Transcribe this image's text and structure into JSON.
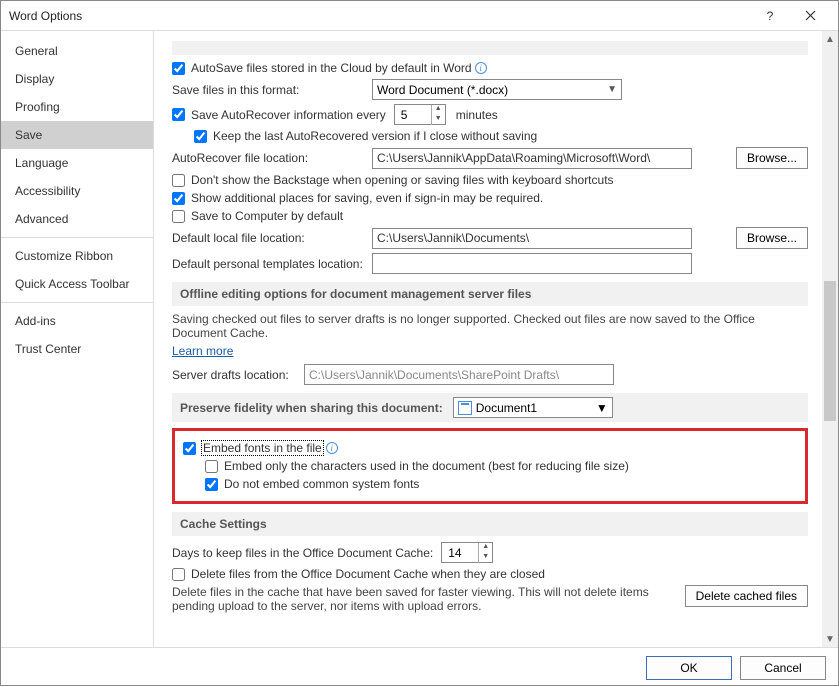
{
  "title": "Word Options",
  "sidebar": {
    "items": [
      {
        "label": "General"
      },
      {
        "label": "Display"
      },
      {
        "label": "Proofing"
      },
      {
        "label": "Save"
      },
      {
        "label": "Language"
      },
      {
        "label": "Accessibility"
      },
      {
        "label": "Advanced"
      },
      {
        "label": "Customize Ribbon"
      },
      {
        "label": "Quick Access Toolbar"
      },
      {
        "label": "Add-ins"
      },
      {
        "label": "Trust Center"
      }
    ]
  },
  "save": {
    "autosave_label": "AutoSave files stored in the Cloud by default in Word",
    "format_label": "Save files in this format:",
    "format_value": "Word Document (*.docx)",
    "autorecover_label": "Save AutoRecover information every",
    "autorecover_minutes": "5",
    "minutes_label": "minutes",
    "keep_last_label": "Keep the last AutoRecovered version if I close without saving",
    "recover_loc_label": "AutoRecover file location:",
    "recover_loc_value": "C:\\Users\\Jannik\\AppData\\Roaming\\Microsoft\\Word\\",
    "browse_label": "Browse...",
    "dont_show_backstage": "Don't show the Backstage when opening or saving files with keyboard shortcuts",
    "show_additional": "Show additional places for saving, even if sign-in may be required.",
    "save_computer": "Save to Computer by default",
    "default_local_label": "Default local file location:",
    "default_local_value": "C:\\Users\\Jannik\\Documents\\",
    "personal_templates_label": "Default personal templates location:",
    "personal_templates_value": ""
  },
  "offline": {
    "header": "Offline editing options for document management server files",
    "desc": "Saving checked out files to server drafts is no longer supported. Checked out files are now saved to the Office Document Cache.",
    "learn_more": "Learn more",
    "drafts_label": "Server drafts location:",
    "drafts_value": "C:\\Users\\Jannik\\Documents\\SharePoint Drafts\\"
  },
  "preserve": {
    "header": "Preserve fidelity when sharing this document:",
    "doc_value": "Document1",
    "embed_fonts": "Embed fonts in the file",
    "embed_chars": "Embed only the characters used in the document (best for reducing file size)",
    "no_common": "Do not embed common system fonts"
  },
  "cache": {
    "header": "Cache Settings",
    "days_label": "Days to keep files in the Office Document Cache:",
    "days_value": "14",
    "delete_closed": "Delete files from the Office Document Cache when they are closed",
    "delete_desc": "Delete files in the cache that have been saved for faster viewing. This will not delete items pending upload to the server, nor items with upload errors.",
    "delete_btn": "Delete cached files"
  },
  "footer": {
    "ok": "OK",
    "cancel": "Cancel"
  }
}
